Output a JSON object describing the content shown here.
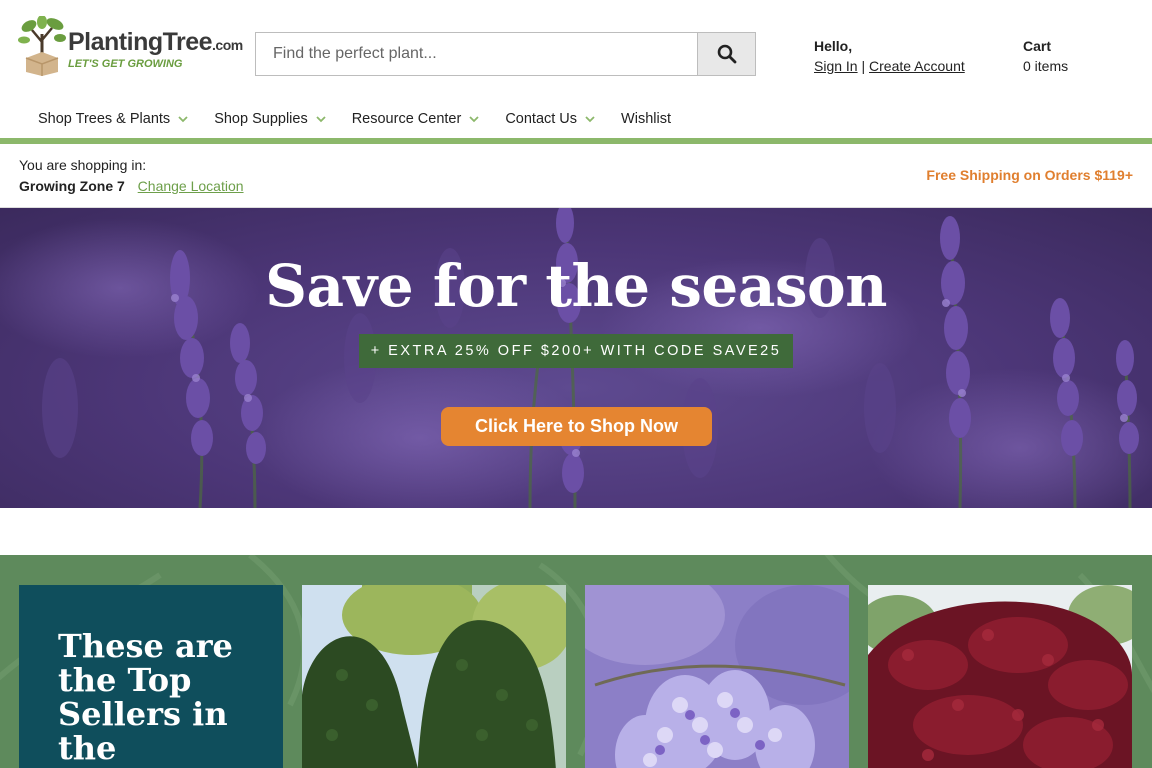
{
  "brand": {
    "name": "PlantingTree",
    "domain_suffix": ".com",
    "tagline": "LET'S GET GROWING"
  },
  "search": {
    "placeholder": "Find the perfect plant...",
    "icon": "search-icon"
  },
  "account": {
    "greeting": "Hello,",
    "sign_in": "Sign In",
    "separator": "|",
    "create_account": "Create Account"
  },
  "cart": {
    "label": "Cart",
    "count": "0 items"
  },
  "nav": {
    "items": [
      {
        "label": "Shop Trees & Plants",
        "has_dropdown": true
      },
      {
        "label": "Shop Supplies",
        "has_dropdown": true
      },
      {
        "label": "Resource Center",
        "has_dropdown": true
      },
      {
        "label": "Contact Us",
        "has_dropdown": true
      },
      {
        "label": "Wishlist",
        "has_dropdown": false
      }
    ]
  },
  "location": {
    "prefix": "You are shopping in:",
    "zone": "Growing Zone 7",
    "change_link": "Change Location"
  },
  "shipping_banner": "Free Shipping on Orders $119+",
  "hero": {
    "title": "Save for the season",
    "promo": "+ EXTRA 25% OFF $200+ WITH CODE SAVE25",
    "cta": "Click Here to Shop Now"
  },
  "top_sellers": {
    "heading": "These are the Top Sellers in the Nursery",
    "cards": [
      {
        "image": "holly-trees-photo"
      },
      {
        "image": "wisteria-photo"
      },
      {
        "image": "japanese-maple-photo"
      }
    ]
  },
  "colors": {
    "accent_green": "#8cb86b",
    "link_green": "#6d9f4a",
    "orange": "#e58531",
    "shipping_orange": "#e07f2f",
    "promo_green": "#3f6a3a",
    "section_green": "#5e8a5c",
    "intro_teal": "#0f4e5c"
  }
}
